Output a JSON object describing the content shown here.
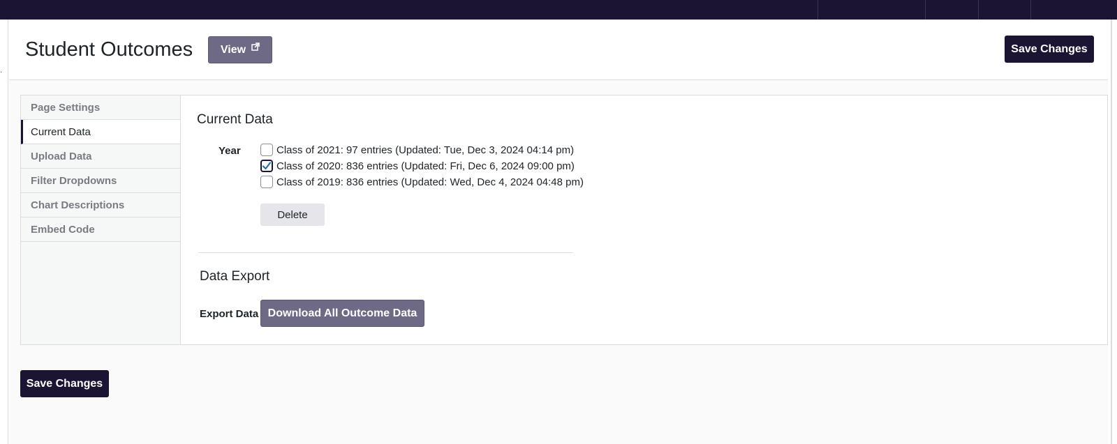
{
  "header": {
    "title": "Student Outcomes",
    "view_label": "View",
    "save_label": "Save Changes"
  },
  "sidebar": {
    "tabs": [
      {
        "label": "Page Settings",
        "active": false
      },
      {
        "label": "Current Data",
        "active": true
      },
      {
        "label": "Upload Data",
        "active": false
      },
      {
        "label": "Filter Dropdowns",
        "active": false
      },
      {
        "label": "Chart Descriptions",
        "active": false
      },
      {
        "label": "Embed Code",
        "active": false
      }
    ]
  },
  "current_data": {
    "title": "Current Data",
    "year_label": "Year",
    "years": [
      {
        "label": "Class of 2021: 97 entries (Updated: Tue, Dec 3, 2024 04:14 pm)",
        "checked": false
      },
      {
        "label": "Class of 2020: 836 entries (Updated: Fri, Dec 6, 2024 09:00 pm)",
        "checked": true
      },
      {
        "label": "Class of 2019: 836 entries (Updated: Wed, Dec 4, 2024 04:48 pm)",
        "checked": false
      }
    ],
    "delete_label": "Delete"
  },
  "data_export": {
    "title": "Data Export",
    "export_label": "Export Data",
    "download_label": "Download All Outcome Data"
  },
  "footer": {
    "save_label": "Save Changes"
  },
  "colors": {
    "brand_dark": "#1b1533",
    "button_muted": "#6e6a85",
    "check": "#2271b1"
  }
}
